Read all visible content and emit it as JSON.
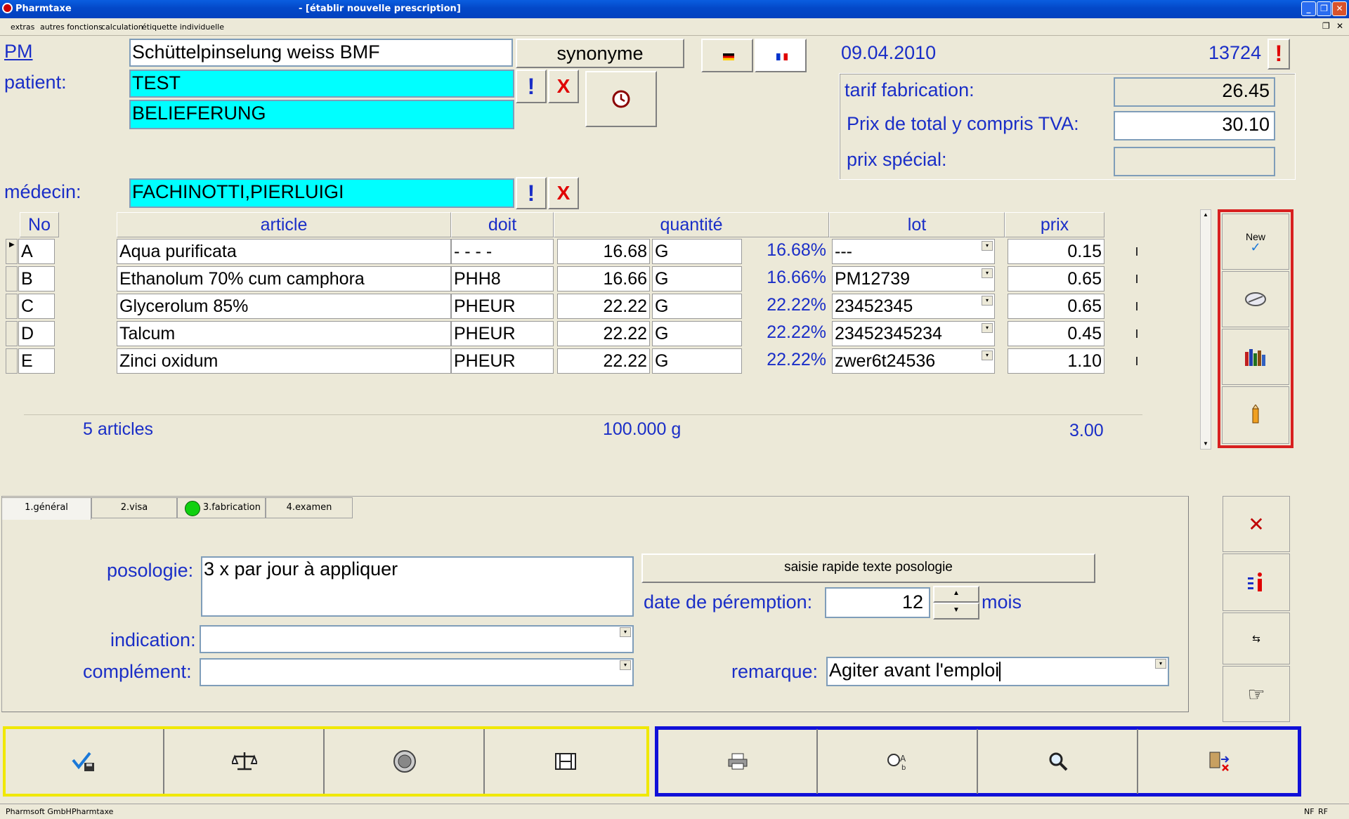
{
  "window": {
    "app_title": "Pharmtaxe",
    "title": "- [établir nouvelle prescription]"
  },
  "menu": [
    "extras",
    "autres fonctions",
    "calculation",
    "étiquette individuelle"
  ],
  "form": {
    "pm_label": "PM",
    "pm_value": "Schüttelpinselung weiss BMF",
    "synonym_label": "synonyme",
    "patient_label": "patient:",
    "patient_line1": "TEST",
    "patient_line2": "BELIEFERUNG",
    "doctor_label": "médecin:",
    "doctor_value": "FACHINOTTI,PIERLUIGI",
    "excl": "!",
    "x": "X",
    "date": "09.04.2010",
    "number": "13724",
    "tarif_label": "tarif fabrication:",
    "tarif_value": "26.45",
    "total_label": "Prix de total y compris TVA:",
    "total_value": "30.10",
    "special_label": "prix spécial:",
    "special_value": ""
  },
  "table": {
    "headers": {
      "no": "No",
      "article": "article",
      "doit": "doit",
      "quantite": "quantité",
      "lot": "lot",
      "prix": "prix"
    },
    "rows": [
      {
        "no": "A",
        "article": "Aqua purificata",
        "doit": "- - - -",
        "qty": "16.68",
        "unit": "G",
        "pct": "16.68%",
        "lot": "---",
        "prix": "0.15"
      },
      {
        "no": "B",
        "article": "Ethanolum 70% cum camphora",
        "doit": "PHH8",
        "qty": "16.66",
        "unit": "G",
        "pct": "16.66%",
        "lot": "PM12739",
        "prix": "0.65"
      },
      {
        "no": "C",
        "article": "Glycerolum 85%",
        "doit": "PHEUR",
        "qty": "22.22",
        "unit": "G",
        "pct": "22.22%",
        "lot": "23452345",
        "prix": "0.65"
      },
      {
        "no": "D",
        "article": "Talcum",
        "doit": "PHEUR",
        "qty": "22.22",
        "unit": "G",
        "pct": "22.22%",
        "lot": "23452345234",
        "prix": "0.45"
      },
      {
        "no": "E",
        "article": "Zinci oxidum",
        "doit": "PHEUR",
        "qty": "22.22",
        "unit": "G",
        "pct": "22.22%",
        "lot": "zwer6t24536",
        "prix": "1.10"
      }
    ],
    "summary": {
      "articles": "5 articles",
      "total_qty": "100.000 g",
      "total_price": "3.00"
    }
  },
  "side": {
    "new_label": "New"
  },
  "tabs": [
    "1.général",
    "2.visa",
    "3.fabrication",
    "4.examen"
  ],
  "general": {
    "posologie_label": "posologie:",
    "posologie_value": "3 x par jour à appliquer",
    "quick_text_button": "saisie rapide texte posologie",
    "expiry_label": "date de péremption:",
    "expiry_value": "12",
    "expiry_unit": "mois",
    "indication_label": "indication:",
    "indication_value": "",
    "complement_label": "complément:",
    "complement_value": "",
    "remark_label": "remarque:",
    "remark_value": "Agiter avant l'emploi"
  },
  "status": {
    "company": "Pharmsoft GmbH",
    "app": "Pharmtaxe",
    "nf": "NF",
    "rf": "RF"
  },
  "colors": {
    "accent_blue": "#1a2ec7",
    "cyan_field": "#00ffff",
    "alert_red": "#e00000",
    "frame_yellow": "#f0e800",
    "frame_blue": "#1010d8",
    "frame_red": "#d82020",
    "tab_green": "#10d010"
  }
}
